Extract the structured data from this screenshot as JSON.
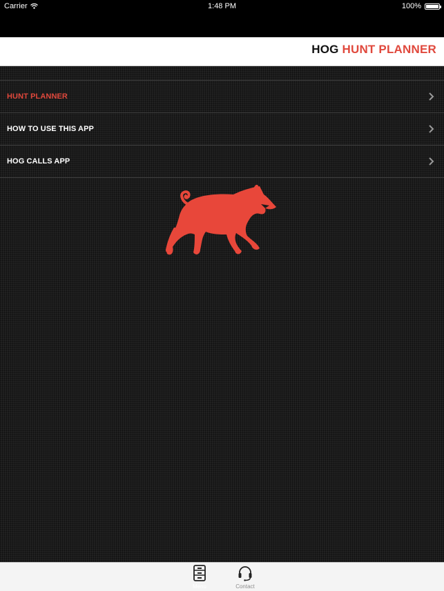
{
  "status_bar": {
    "carrier": "Carrier",
    "time": "1:48 PM",
    "battery": "100%"
  },
  "header": {
    "title_part1": "HOG",
    "title_part2": "HUNT PLANNER"
  },
  "menu": {
    "items": [
      {
        "label": "HUNT PLANNER"
      },
      {
        "label": "HOW TO USE THIS APP"
      },
      {
        "label": "HOG CALLS APP"
      }
    ]
  },
  "tab_bar": {
    "tabs": [
      {
        "label": "Menu"
      },
      {
        "label": "Contact"
      }
    ]
  },
  "colors": {
    "accent": "#e0483c",
    "background": "#1c1c1c",
    "header_bg": "#ffffff"
  },
  "icons": [
    "wifi-icon",
    "battery-icon",
    "chevron-right-icon",
    "hog-logo",
    "menu-icon",
    "headset-icon"
  ]
}
